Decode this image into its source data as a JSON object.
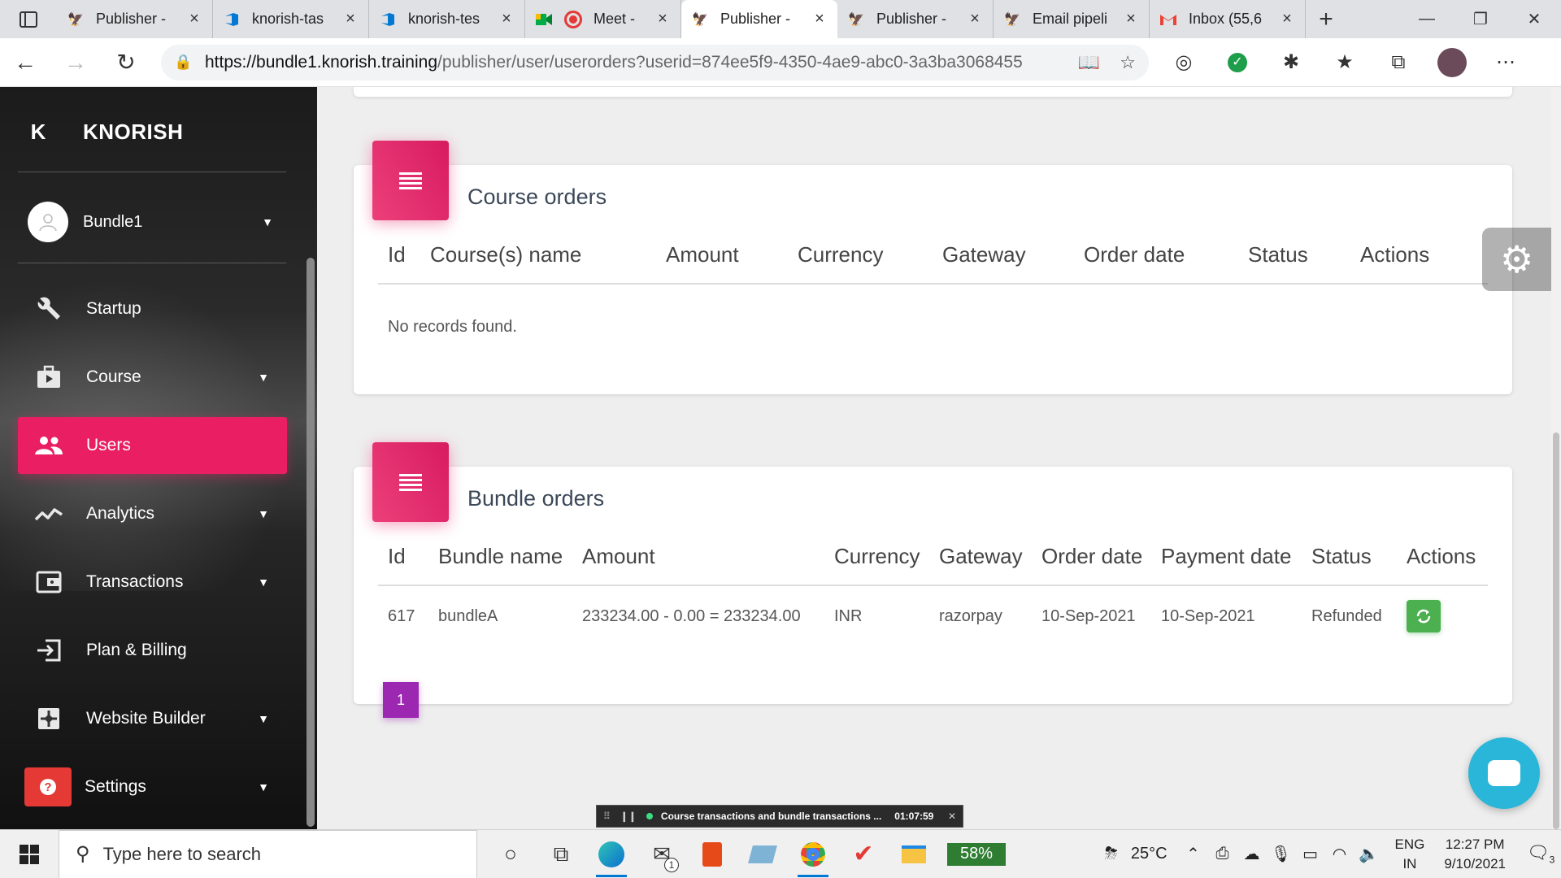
{
  "browser": {
    "tabs": [
      {
        "title": "Publisher - ",
        "icon": "knorish-icon",
        "active": false
      },
      {
        "title": "knorish-tas",
        "icon": "azure-devops-icon",
        "active": false
      },
      {
        "title": "knorish-tes",
        "icon": "azure-devops-icon",
        "active": false
      },
      {
        "title": "Meet - ",
        "icon": "google-meet-icon",
        "active": false
      },
      {
        "title": "Publisher - ",
        "icon": "knorish-icon",
        "active": true
      },
      {
        "title": "Publisher - ",
        "icon": "knorish-icon",
        "active": false
      },
      {
        "title": "Email pipeli",
        "icon": "knorish-icon",
        "active": false
      },
      {
        "title": "Inbox (55,6",
        "icon": "gmail-icon",
        "active": false
      }
    ],
    "url_host": "https://bundle1.knorish.training",
    "url_path": "/publisher/user/userorders?userid=874ee5f9-4350-4ae9-abc0-3a3ba3068455"
  },
  "sidebar": {
    "logo_letter": "K",
    "brand": "KNORISH",
    "user_name": "Bundle1",
    "items": [
      {
        "label": "Startup",
        "icon": "wrench-icon",
        "has_caret": false,
        "active": false
      },
      {
        "label": "Course",
        "icon": "briefcase-icon",
        "has_caret": true,
        "active": false
      },
      {
        "label": "Users",
        "icon": "users-icon",
        "has_caret": false,
        "active": true
      },
      {
        "label": "Analytics",
        "icon": "trending-icon",
        "has_caret": true,
        "active": false
      },
      {
        "label": "Transactions",
        "icon": "wallet-icon",
        "has_caret": true,
        "active": false
      },
      {
        "label": "Plan & Billing",
        "icon": "exit-icon",
        "has_caret": false,
        "active": false
      },
      {
        "label": "Website Builder",
        "icon": "widgets-icon",
        "has_caret": true,
        "active": false
      },
      {
        "label": "Settings",
        "icon": "help-icon",
        "has_caret": true,
        "active": false
      }
    ]
  },
  "course_orders": {
    "title": "Course orders",
    "columns": [
      "Id",
      "Course(s) name",
      "Amount",
      "Currency",
      "Gateway",
      "Order date",
      "Status",
      "Actions"
    ],
    "empty_text": "No records found."
  },
  "bundle_orders": {
    "title": "Bundle orders",
    "columns": [
      "Id",
      "Bundle name",
      "Amount",
      "Currency",
      "Gateway",
      "Order date",
      "Payment date",
      "Status",
      "Actions"
    ],
    "rows": [
      [
        "617",
        "bundleA",
        "233234.00 - 0.00 = 233234.00",
        "INR",
        "razorpay",
        "10-Sep-2021",
        "10-Sep-2021",
        "Refunded"
      ]
    ],
    "page": "1"
  },
  "recording_bar": {
    "title": "Course transactions and bundle transactions ...",
    "time": "01:07:59"
  },
  "taskbar": {
    "search_placeholder": "Type here to search",
    "battery": "58%",
    "temperature": "25°C",
    "lang_1": "ENG",
    "lang_2": "IN",
    "time": "12:27 PM",
    "date": "9/10/2021",
    "mail_badge": "1",
    "notif_count": "3"
  },
  "colors": {
    "accent": "#e91e63",
    "success": "#4caf50",
    "pager": "#9c27b0",
    "chat": "#2ab6d9"
  }
}
